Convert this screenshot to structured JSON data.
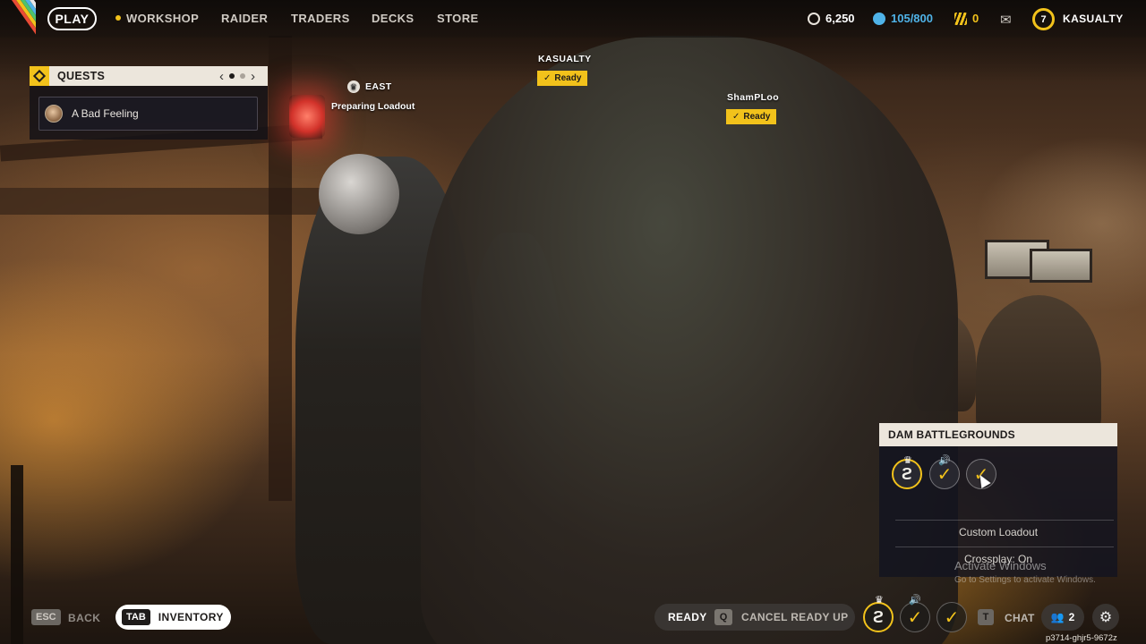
{
  "nav": {
    "play": "PLAY",
    "items": [
      "WORKSHOP",
      "RAIDER",
      "TRADERS",
      "DECKS",
      "STORE"
    ],
    "currencies": [
      {
        "icon": "coins-icon",
        "value": "6,250"
      },
      {
        "icon": "credits-icon",
        "value": "105/800",
        "color": "#4fb3e8"
      },
      {
        "icon": "tokens-icon",
        "value": "0",
        "color": "#f2c21b"
      }
    ],
    "level": "7",
    "username": "KASUALTY"
  },
  "quests": {
    "title": "QUESTS",
    "prev": "‹",
    "next": "›",
    "active_quest": "A Bad Feeling"
  },
  "squad": {
    "leader_marker": "EAST",
    "leader_status": "Preparing Loadout",
    "members": [
      {
        "name": "KASUALTY",
        "status": "Ready"
      },
      {
        "name": "ShamPLoo",
        "status": "Ready"
      }
    ]
  },
  "map_panel": {
    "map_name": "DAM BATTLEGROUNDS",
    "loadout": "Custom Loadout",
    "crossplay": "Crossplay: On"
  },
  "windows_watermark": {
    "title": "Activate Windows",
    "subtitle": "Go to Settings to activate Windows."
  },
  "bottom": {
    "esc_key": "ESC",
    "back": "BACK",
    "tab_key": "TAB",
    "inventory": "INVENTORY",
    "ready": "READY",
    "q_key": "Q",
    "cancel_ready": "CANCEL READY UP",
    "t_key": "T",
    "chat": "CHAT",
    "friends_count": "2",
    "session_code": "p3714-ghjr5-9672z"
  },
  "colors": {
    "accent": "#f2c21b",
    "panel_header": "#ece6dc"
  }
}
